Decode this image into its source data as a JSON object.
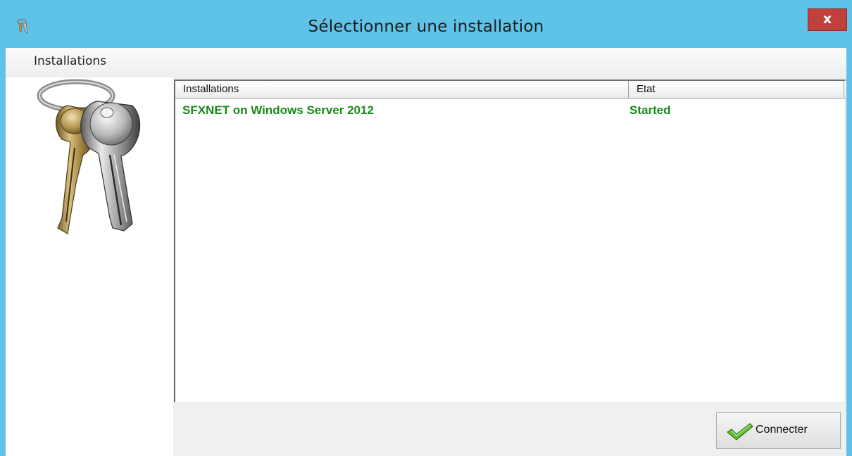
{
  "window": {
    "title": "Sélectionner une installation",
    "close_label": "x",
    "accent_color": "#5fc3e8"
  },
  "tabs": [
    {
      "label": "Installations"
    }
  ],
  "left_panel": {
    "icon": "keys-icon"
  },
  "installations_list": {
    "columns": [
      "Installations",
      "Etat"
    ],
    "rows": [
      {
        "name": "SFXNET on Windows Server 2012",
        "status": "Started",
        "color": "#1a8a1a"
      }
    ]
  },
  "buttons": {
    "connect_label": "Connecter",
    "connect_icon": "checkmark-icon"
  }
}
